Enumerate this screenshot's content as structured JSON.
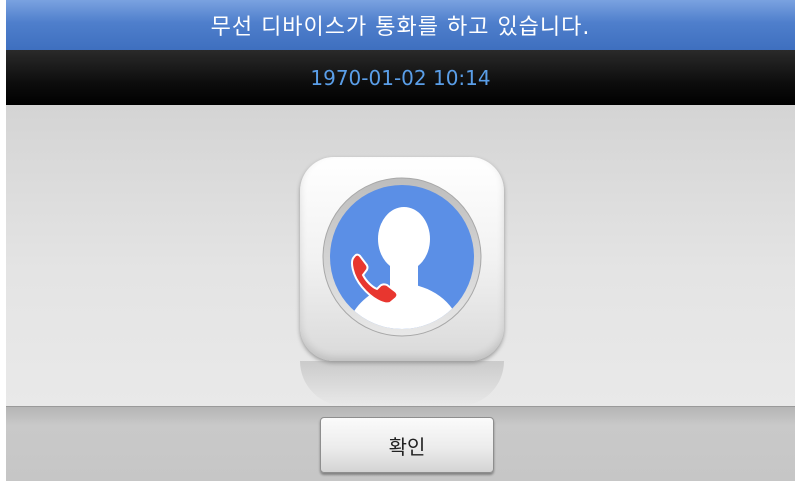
{
  "header": {
    "title": "무선 디바이스가 통화를 하고 있습니다."
  },
  "status": {
    "datetime": "1970-01-02 10:14"
  },
  "main": {
    "icon": "contact-call-icon",
    "colors": {
      "circle": "#5b8fe6",
      "handset": "#e8362f",
      "silhouette": "#ffffff"
    }
  },
  "footer": {
    "confirm_label": "확인"
  }
}
